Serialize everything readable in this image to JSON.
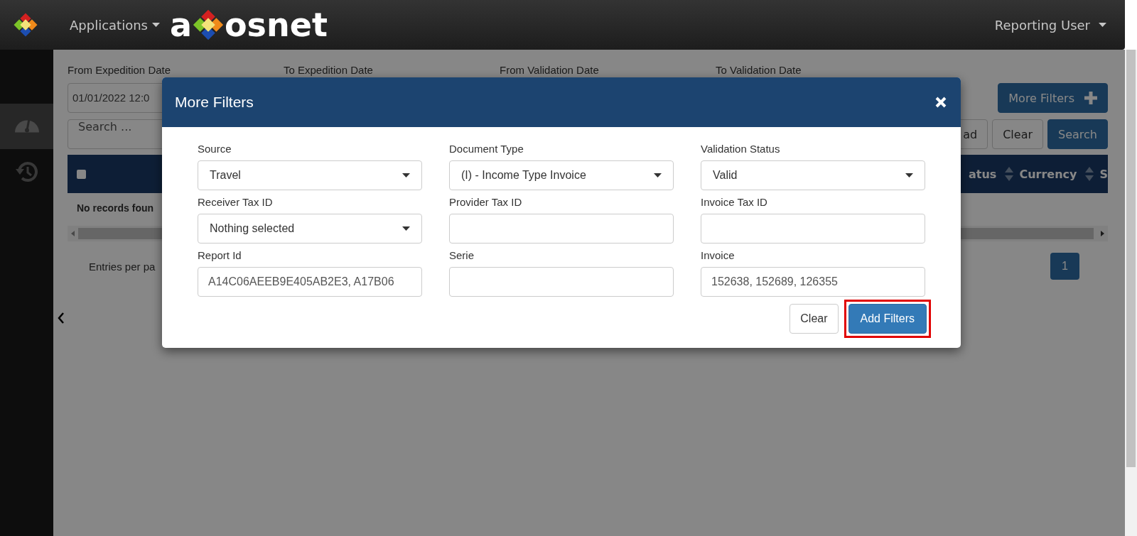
{
  "header": {
    "applications_menu": "Applications",
    "brand": {
      "prefix": "a",
      "suffix": "osnet"
    },
    "user_menu": "Reporting User"
  },
  "sidebar": {
    "items": [
      {
        "kind": "gauge",
        "selected": true
      },
      {
        "kind": "history",
        "selected": false
      }
    ]
  },
  "filters": {
    "date_labels": [
      "From Expedition Date",
      "To Expedition Date",
      "From Validation Date",
      "To Validation Date"
    ],
    "from_expedition_date": "01/01/2022 12:0",
    "search": {
      "placeholder": "Search ..."
    },
    "more_filters_button": "More Filters",
    "download_button": "ad",
    "clear_button": "Clear",
    "search_button": "Search"
  },
  "table": {
    "select_all": {
      "checked": false
    },
    "columns": [
      "atus",
      "Currency",
      "S"
    ],
    "empty_message": "No records foun"
  },
  "footer": {
    "entries_label": "Entries per pa",
    "pages": [
      {
        "label": "1",
        "selected": true
      }
    ]
  },
  "modal": {
    "title": "More Filters",
    "fields": [
      {
        "kind": "select",
        "label": "Source",
        "value": "Travel"
      },
      {
        "kind": "select",
        "label": "Document Type",
        "value": "(I) - Income Type Invoice"
      },
      {
        "kind": "select",
        "label": "Validation Status",
        "value": "Valid"
      },
      {
        "kind": "select",
        "label": "Receiver Tax ID",
        "value": "Nothing selected"
      },
      {
        "kind": "input",
        "label": "Provider Tax ID"
      },
      {
        "kind": "input",
        "label": "Invoice Tax ID"
      },
      {
        "kind": "input",
        "label": "Report Id",
        "value": "A14C06AEEB9E405AB2E3, A17B06"
      },
      {
        "kind": "input",
        "label": "Serie"
      },
      {
        "kind": "input",
        "label": "Invoice",
        "value": "152638, 152689, 126355"
      }
    ],
    "buttons": [
      {
        "kind": "default",
        "label": "Clear",
        "highlighted": false
      },
      {
        "kind": "primary",
        "label": "Add Filters",
        "highlighted": true
      }
    ]
  }
}
